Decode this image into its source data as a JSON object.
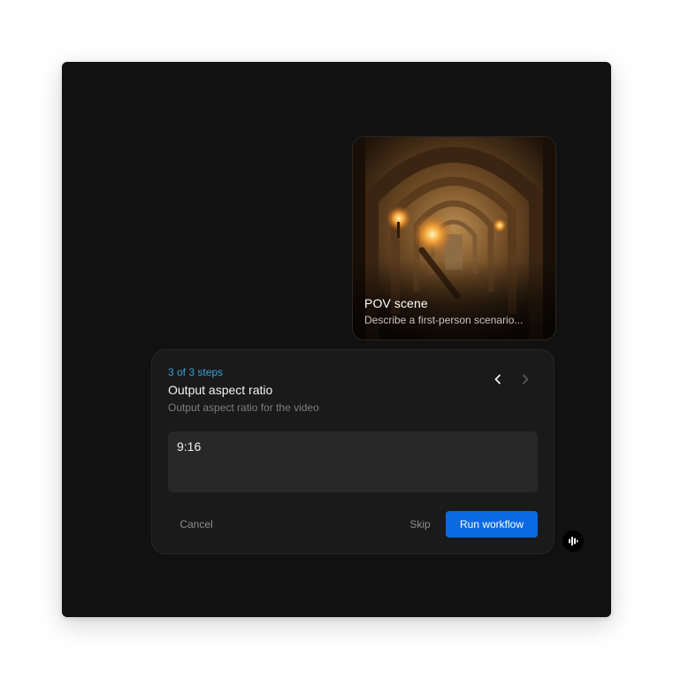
{
  "scene_card": {
    "title": "POV scene",
    "description": "Describe a first-person scenario..."
  },
  "workflow": {
    "step_counter": "3 of 3 steps",
    "step_title": "Output aspect ratio",
    "step_description": "Output aspect ratio for the video",
    "value": "9:16",
    "cancel_label": "Cancel",
    "skip_label": "Skip",
    "run_label": "Run workflow"
  },
  "icons": {
    "prev": "chevron-left-icon",
    "next": "chevron-right-icon",
    "fab": "waveform-icon"
  },
  "colors": {
    "window_bg": "#111111",
    "panel_bg": "#1a1a1a",
    "accent_blue": "#0b69e3",
    "step_counter": "#3a9fd6"
  }
}
